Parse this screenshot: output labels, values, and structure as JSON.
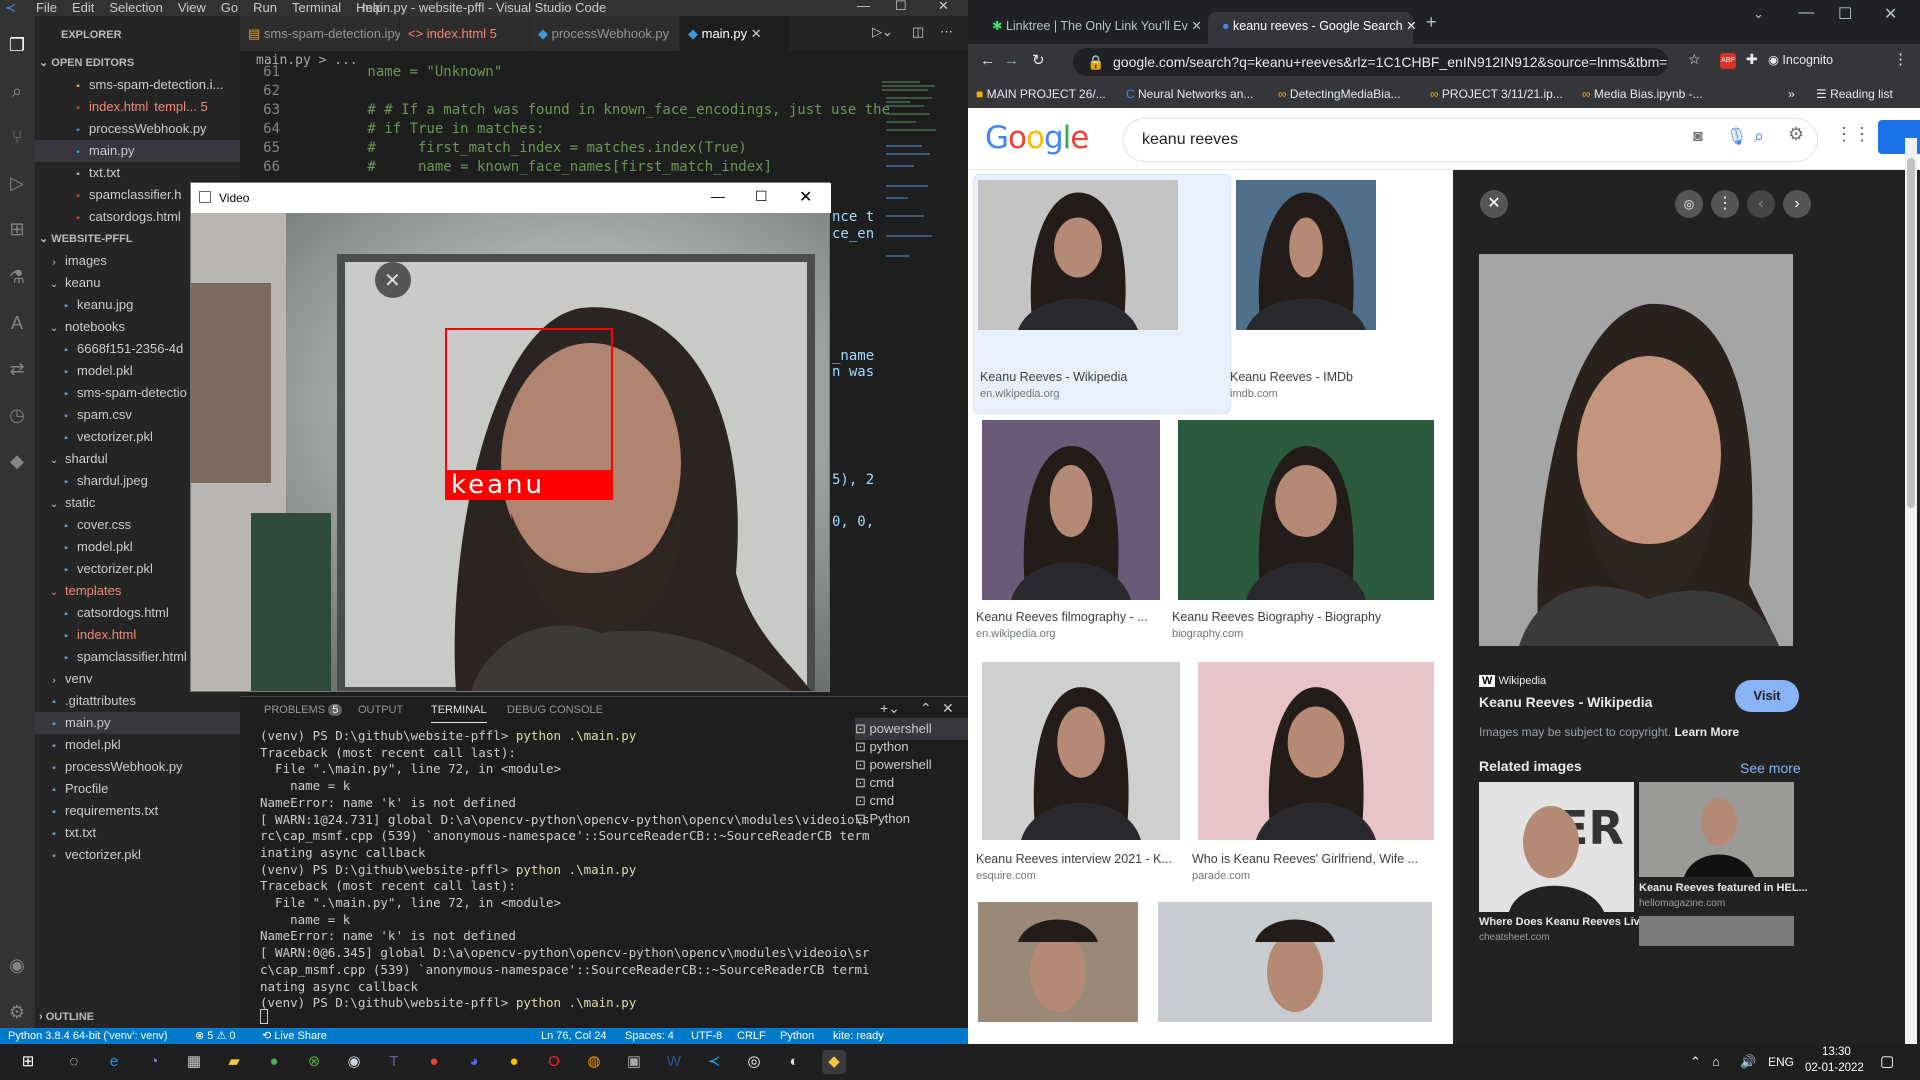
{
  "vscode": {
    "menu": [
      "File",
      "Edit",
      "Selection",
      "View",
      "Go",
      "Run",
      "Terminal",
      "Help"
    ],
    "title": "main.py - website-pffl - Visual Studio Code",
    "sidebar": {
      "explorer_label": "EXPLORER",
      "open_editors_label": "OPEN EDITORS",
      "open_editors": [
        {
          "name": "sms-spam-detection.i...",
          "badge": "",
          "color": "#ccc"
        },
        {
          "name": "index.html",
          "badge": "templ... 5",
          "color": "#f48771"
        },
        {
          "name": "processWebhook.py",
          "badge": "",
          "color": "#ccc"
        },
        {
          "name": "main.py",
          "badge": "",
          "color": "#ccc"
        },
        {
          "name": "txt.txt",
          "badge": "",
          "color": "#ccc"
        },
        {
          "name": "spamclassifier.h",
          "badge": "",
          "color": "#ccc"
        },
        {
          "name": "catsordogs.html",
          "badge": "",
          "color": "#ccc"
        }
      ],
      "workspace_label": "WEBSITE-PFFL",
      "tree": [
        {
          "name": "images",
          "indent": 1,
          "kind": "folder"
        },
        {
          "name": "keanu",
          "indent": 1,
          "kind": "folder-open"
        },
        {
          "name": "keanu.jpg",
          "indent": 2,
          "kind": "file"
        },
        {
          "name": "notebooks",
          "indent": 1,
          "kind": "folder-open"
        },
        {
          "name": "6668f151-2356-4d",
          "indent": 2,
          "kind": "file"
        },
        {
          "name": "model.pkl",
          "indent": 2,
          "kind": "file"
        },
        {
          "name": "sms-spam-detectio",
          "indent": 2,
          "kind": "file"
        },
        {
          "name": "spam.csv",
          "indent": 2,
          "kind": "file"
        },
        {
          "name": "vectorizer.pkl",
          "indent": 2,
          "kind": "file"
        },
        {
          "name": "shardul",
          "indent": 1,
          "kind": "folder-open"
        },
        {
          "name": "shardul.jpeg",
          "indent": 2,
          "kind": "file"
        },
        {
          "name": "static",
          "indent": 1,
          "kind": "folder-open"
        },
        {
          "name": "cover.css",
          "indent": 2,
          "kind": "file"
        },
        {
          "name": "model.pkl",
          "indent": 2,
          "kind": "file"
        },
        {
          "name": "vectorizer.pkl",
          "indent": 2,
          "kind": "file"
        },
        {
          "name": "templates",
          "indent": 1,
          "kind": "folder-open"
        },
        {
          "name": "catsordogs.html",
          "indent": 2,
          "kind": "file"
        },
        {
          "name": "index.html",
          "indent": 2,
          "kind": "file"
        },
        {
          "name": "spamclassifier.html",
          "indent": 2,
          "kind": "file"
        },
        {
          "name": "venv",
          "indent": 1,
          "kind": "folder"
        },
        {
          "name": ".gitattributes",
          "indent": 1,
          "kind": "file"
        },
        {
          "name": "main.py",
          "indent": 1,
          "kind": "file"
        },
        {
          "name": "model.pkl",
          "indent": 1,
          "kind": "file"
        },
        {
          "name": "processWebhook.py",
          "indent": 1,
          "kind": "file"
        },
        {
          "name": "Procfile",
          "indent": 1,
          "kind": "file"
        },
        {
          "name": "requirements.txt",
          "indent": 1,
          "kind": "file"
        },
        {
          "name": "txt.txt",
          "indent": 1,
          "kind": "file"
        },
        {
          "name": "vectorizer.pkl",
          "indent": 1,
          "kind": "file"
        }
      ],
      "outline_label": "OUTLINE"
    },
    "tabs": [
      {
        "label": "sms-spam-detection.ipynb",
        "badge": ""
      },
      {
        "label": "index.html",
        "badge": "5"
      },
      {
        "label": "processWebhook.py",
        "badge": ""
      },
      {
        "label": "main.py",
        "badge": ""
      }
    ],
    "breadcrumb": "main.py > ...",
    "code": [
      {
        "ln": "61",
        "text": "        name = \"Unknown\""
      },
      {
        "ln": "62",
        "text": ""
      },
      {
        "ln": "63",
        "text": "        # # If a match was found in known_face_encodings, just use the"
      },
      {
        "ln": "64",
        "text": "        # if True in matches:"
      },
      {
        "ln": "65",
        "text": "        #     first_match_index = matches.index(True)"
      },
      {
        "ln": "66",
        "text": "        #     name = known_face_names[first_match_index]"
      }
    ],
    "right_fragments": [
      "nce t",
      "ce_en",
      "_name",
      "n was",
      "5), 2",
      "0, 0,"
    ],
    "panel_tabs": [
      "PROBLEMS",
      "5",
      "OUTPUT",
      "TERMINAL",
      "DEBUG CONSOLE"
    ],
    "terminal": [
      {
        "t": "(venv) PS D:\\github\\website-pffl> ",
        "cmd": "python .\\main.py"
      },
      {
        "t": "Traceback (most recent call last):",
        "cmd": ""
      },
      {
        "t": "  File \".\\main.py\", line 72, in <module>",
        "cmd": ""
      },
      {
        "t": "    name = k",
        "cmd": ""
      },
      {
        "t": "NameError: name 'k' is not defined",
        "cmd": ""
      },
      {
        "t": "[ WARN:1@24.731] global D:\\a\\opencv-python\\opencv-python\\opencv\\modules\\videoio\\s",
        "cmd": ""
      },
      {
        "t": "rc\\cap_msmf.cpp (539) `anonymous-namespace'::SourceReaderCB::~SourceReaderCB term",
        "cmd": ""
      },
      {
        "t": "inating async callback",
        "cmd": ""
      },
      {
        "t": "(venv) PS D:\\github\\website-pffl> ",
        "cmd": "python .\\main.py"
      },
      {
        "t": "Traceback (most recent call last):",
        "cmd": ""
      },
      {
        "t": "  File \".\\main.py\", line 72, in <module>",
        "cmd": ""
      },
      {
        "t": "    name = k",
        "cmd": ""
      },
      {
        "t": "NameError: name 'k' is not defined",
        "cmd": ""
      },
      {
        "t": "[ WARN:0@6.345] global D:\\a\\opencv-python\\opencv-python\\opencv\\modules\\videoio\\sr",
        "cmd": ""
      },
      {
        "t": "c\\cap_msmf.cpp (539) `anonymous-namespace'::SourceReaderCB::~SourceReaderCB termi",
        "cmd": ""
      },
      {
        "t": "nating async callback",
        "cmd": ""
      },
      {
        "t": "(venv) PS D:\\github\\website-pffl> ",
        "cmd": "python .\\main.py"
      }
    ],
    "terminal_list": [
      "powershell",
      "python",
      "powershell",
      "cmd",
      "cmd",
      "Python"
    ],
    "status": {
      "interpreter": "Python 3.8.4 64-bit ('venv': venv)",
      "problems": "⊗ 5 ⚠ 0",
      "live_share": "Live Share",
      "position": "Ln 76, Col 24",
      "spaces": "Spaces: 4",
      "encoding": "UTF-8",
      "eol": "CRLF",
      "language": "Python",
      "kite": "kite: ready"
    }
  },
  "video_window": {
    "title": "Video",
    "label": "keanu",
    "box_color": "#ff0000"
  },
  "chrome": {
    "tabs": [
      {
        "title": "Linktree | The Only Link You'll Ev"
      },
      {
        "title": "keanu reeves - Google Search"
      }
    ],
    "url": "google.com/search?q=keanu+reeves&rlz=1C1CHBF_enIN912IN912&source=lnms&tbm=is...",
    "profile": "Incognito",
    "bookmarks": [
      "MAIN PROJECT 26/...",
      "Neural Networks an...",
      "DetectingMediaBia...",
      "PROJECT 3/11/21.ip...",
      "Media Bias.ipynb -..."
    ],
    "reading_list": "Reading list",
    "google_logo": "Google",
    "query": "keanu reeves",
    "results": [
      {
        "caption": "Keanu Reeves - Wikipedia",
        "source": "en.wikipedia.org"
      },
      {
        "caption": "Keanu Reeves - IMDb",
        "source": "imdb.com"
      },
      {
        "caption": "Keanu Reeves filmography - ...",
        "source": "en.wikipedia.org"
      },
      {
        "caption": "Keanu Reeves Biography - Biography",
        "source": "biography.com"
      },
      {
        "caption": "Keanu Reeves interview 2021 - K...",
        "source": "esquire.com"
      },
      {
        "caption": "Who is Keanu Reeves' Girlfriend, Wife ...",
        "source": "parade.com"
      }
    ],
    "panel": {
      "source": "Wikipedia",
      "title": "Keanu Reeves - Wikipedia",
      "visit": "Visit",
      "copyright": "Images may be subject to copyright.",
      "learn_more": "Learn More",
      "related": "Related images",
      "see_more": "See more",
      "related_items": [
        {
          "caption": "Where Does Keanu Reeves Live...",
          "source": "cheatsheet.com"
        },
        {
          "caption": "Keanu Reeves featured in HEL...",
          "source": "hellomagazine.com"
        }
      ]
    }
  },
  "taskbar": {
    "lang": "ENG",
    "time": "13:30",
    "date": "02-01-2022"
  }
}
